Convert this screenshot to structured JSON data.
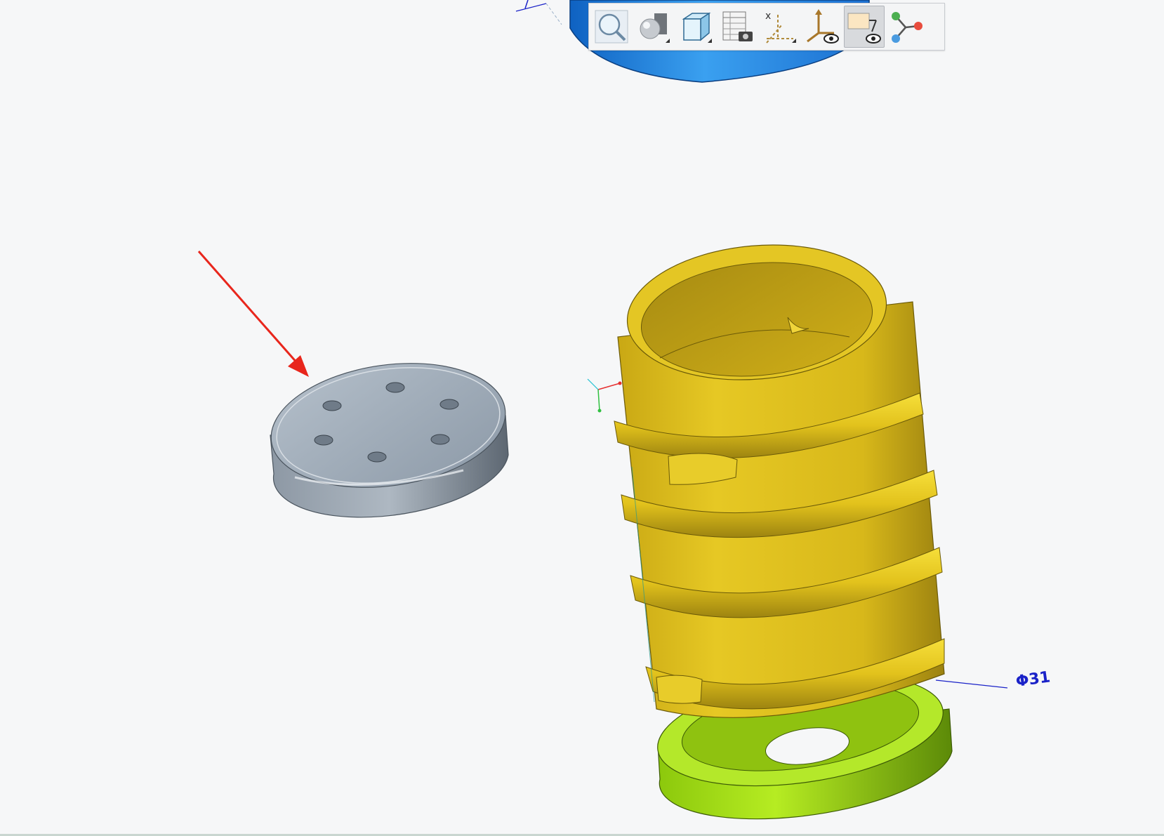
{
  "window": {
    "title": ""
  },
  "toolbar": {
    "buttons": [
      {
        "id": "zoom",
        "icon": "zoom-magnifier-icon",
        "tooltip": ""
      },
      {
        "id": "display-style",
        "icon": "shaded-sphere-icon",
        "tooltip": ""
      },
      {
        "id": "saved-orientations",
        "icon": "cube-view-icon",
        "tooltip": ""
      },
      {
        "id": "view-manager",
        "icon": "table-camera-icon",
        "tooltip": ""
      },
      {
        "id": "datum-display",
        "icon": "datum-axes-icon",
        "tooltip": ""
      },
      {
        "id": "csys-display",
        "icon": "csys-eye-icon",
        "tooltip": ""
      },
      {
        "id": "annotation-display",
        "icon": "annotation-eye-icon",
        "tooltip": "",
        "active": true
      },
      {
        "id": "spin-center",
        "icon": "spin-center-icon",
        "tooltip": ""
      }
    ]
  },
  "annotations": {
    "dimension_label": "Φ31"
  },
  "colors": {
    "background": "#f6f7f8",
    "gray_part": "#9eabb8",
    "yellow_part": "#e3c41f",
    "green_part": "#a8e014",
    "blue_part": "#2a8ae0",
    "arrow": "#e8261c",
    "dimension": "#1a22c8"
  }
}
